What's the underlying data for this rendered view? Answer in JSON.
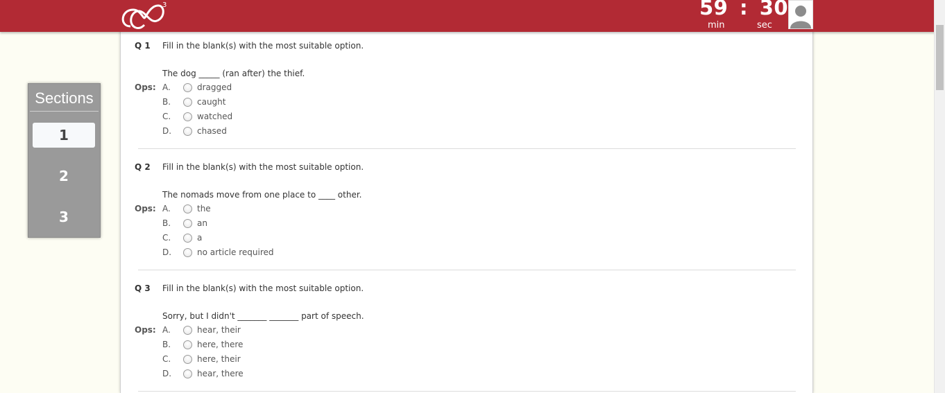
{
  "header": {
    "timer": {
      "minutes": "59",
      "separator": ":",
      "seconds": "30",
      "min_label": "min",
      "sec_label": "sec"
    },
    "logo_superscript": "3",
    "brand_color": "#b22a34"
  },
  "sections": {
    "title": "Sections",
    "items": [
      {
        "label": "1",
        "active": true
      },
      {
        "label": "2",
        "active": false
      },
      {
        "label": "3",
        "active": false
      }
    ]
  },
  "ops_label": "Ops:",
  "questions": [
    {
      "number": "Q 1",
      "instruction": "Fill in the blank(s) with the most suitable option.",
      "stem": "The dog _____ (ran after) the thief.",
      "options": [
        {
          "letter": "A.",
          "text": "dragged"
        },
        {
          "letter": "B.",
          "text": "caught"
        },
        {
          "letter": "C.",
          "text": "watched"
        },
        {
          "letter": "D.",
          "text": "chased"
        }
      ]
    },
    {
      "number": "Q 2",
      "instruction": "Fill in the blank(s) with the most suitable option.",
      "stem": "The nomads move from one place to ____ other.",
      "options": [
        {
          "letter": "A.",
          "text": "the"
        },
        {
          "letter": "B.",
          "text": "an"
        },
        {
          "letter": "C.",
          "text": "a"
        },
        {
          "letter": "D.",
          "text": "no article required"
        }
      ]
    },
    {
      "number": "Q 3",
      "instruction": "Fill in the blank(s) with the most suitable option.",
      "stem": "Sorry, but I didn't _______ _______ part of speech.",
      "options": [
        {
          "letter": "A.",
          "text": "hear, their"
        },
        {
          "letter": "B.",
          "text": "here, there"
        },
        {
          "letter": "C.",
          "text": "here, their"
        },
        {
          "letter": "D.",
          "text": "hear, there"
        }
      ]
    }
  ]
}
